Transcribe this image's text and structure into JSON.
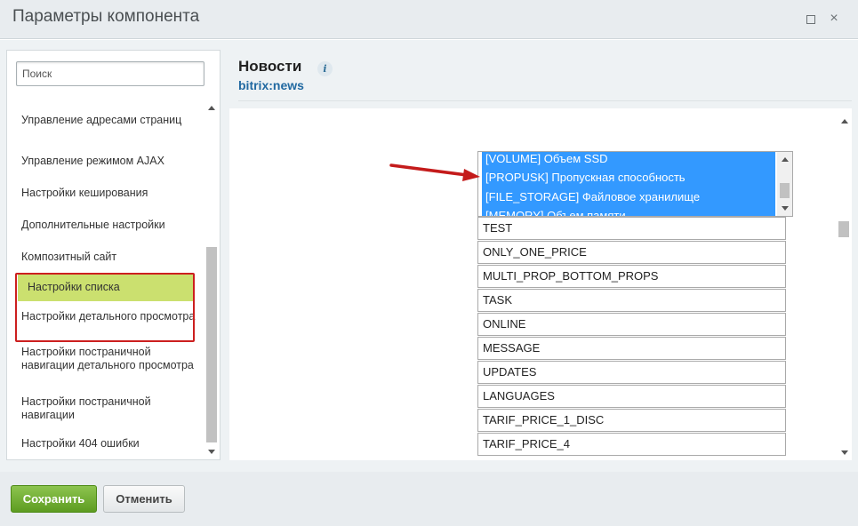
{
  "window": {
    "title": "Параметры компонента",
    "maximize_label": "",
    "close_label": "×"
  },
  "sidebar": {
    "search_placeholder": "Поиск",
    "items": [
      {
        "label": "Управление адресами страниц"
      },
      {
        "label": "Управление режимом AJAX"
      },
      {
        "label": "Настройки кеширования"
      },
      {
        "label": "Дополнительные настройки"
      },
      {
        "label": "Композитный сайт"
      },
      {
        "label": "Настройки списка"
      },
      {
        "label": "Настройки детального просмотра"
      },
      {
        "label": "Настройки постраничной навигации детального просмотра"
      },
      {
        "label": "Настройки постраничной навигации"
      },
      {
        "label": "Настройки 404 ошибки"
      }
    ],
    "active_item": "Настройки списка",
    "highlight_color": "#cbe06f",
    "annotation_color": "#cc1f1f"
  },
  "main": {
    "title": "Новости",
    "info_icon": "i",
    "subtitle": "bitrix:news",
    "multiselect_options": [
      "[VOLUME] Объем SSD",
      "[PROPUSK] Пропускная способность",
      "[FILE_STORAGE] Файловое хранилище",
      "[MEMORY] Объем памяти"
    ],
    "multiselect_color": "#3399ff",
    "fields": [
      "TEST",
      "ONLY_ONE_PRICE",
      "MULTI_PROP_BOTTOM_PROPS",
      "TASK",
      "ONLINE",
      "MESSAGE",
      "UPDATES",
      "LANGUAGES",
      "TARIF_PRICE_1_DISC",
      "TARIF_PRICE_4"
    ]
  },
  "footer": {
    "save_label": "Сохранить",
    "cancel_label": "Отменить",
    "save_color": "#6aa82c"
  }
}
